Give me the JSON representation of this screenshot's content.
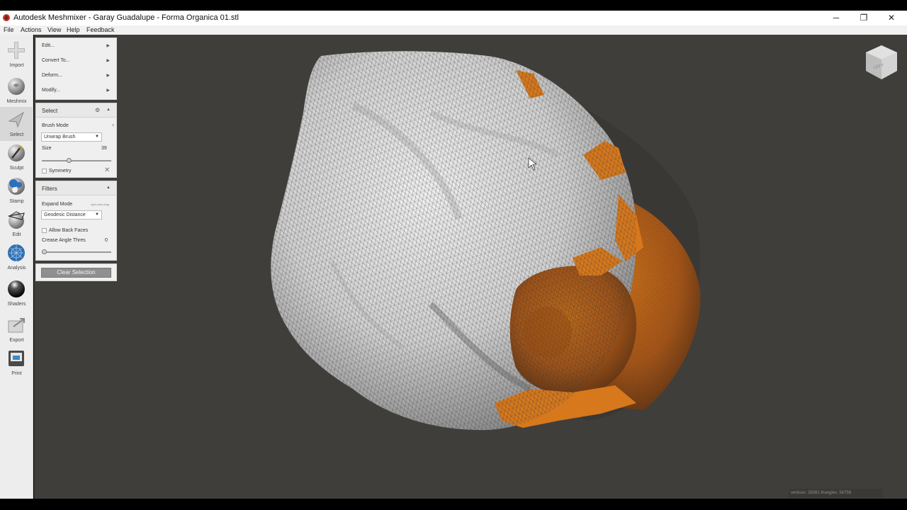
{
  "window": {
    "title": "Autodesk Meshmixer - Garay Guadalupe - Forma Organica 01.stl",
    "controls": [
      "─",
      "❐",
      "✕"
    ]
  },
  "menu": [
    "File",
    "Actions",
    "View",
    "Help",
    "Feedback"
  ],
  "toolbar": [
    {
      "label": "Import",
      "icon": "import-icon"
    },
    {
      "label": "Meshmix",
      "icon": "meshmix-icon"
    },
    {
      "label": "Select",
      "icon": "select-icon",
      "active": true
    },
    {
      "label": "Sculpt",
      "icon": "sculpt-icon"
    },
    {
      "label": "Stamp",
      "icon": "stamp-icon"
    },
    {
      "label": "Edit",
      "icon": "edit-icon"
    },
    {
      "label": "Analysis",
      "icon": "analysis-icon"
    },
    {
      "label": "Shaders",
      "icon": "shaders-icon"
    },
    {
      "label": "Export",
      "icon": "export-icon"
    },
    {
      "label": "Print",
      "icon": "print-icon"
    }
  ],
  "actions_panel": {
    "items": [
      "Edit...",
      "Convert To...",
      "Deform...",
      "Modify..."
    ]
  },
  "select_panel": {
    "title": "Select",
    "brush_mode_label": "Brush Mode",
    "brush_mode_hint": "q",
    "brush_mode_value": "Unwrap Brush",
    "size_label": "Size",
    "size_value": "39",
    "size_level": 0.39,
    "symmetry_label": "Symmetry"
  },
  "filters_panel": {
    "title": "Filters",
    "expand_mode_label": "Expand Mode",
    "expand_mode_hint": "right-click-drag",
    "expand_mode_value": "Geodesic Distance",
    "allow_back_faces_label": "Allow Back Faces",
    "crease_angle_label": "Crease Angle Thres",
    "crease_angle_value": "0",
    "crease_level": 0
  },
  "clear_selection_label": "Clear Selection",
  "status": "vertices: 28381 triangles: 56758",
  "navcube_face": "LEFT",
  "colors": {
    "viewport_bg": "#3f3e3b",
    "mesh": "#d6d6d6",
    "selection": "#d7781c",
    "panel_bg": "#efefef"
  }
}
